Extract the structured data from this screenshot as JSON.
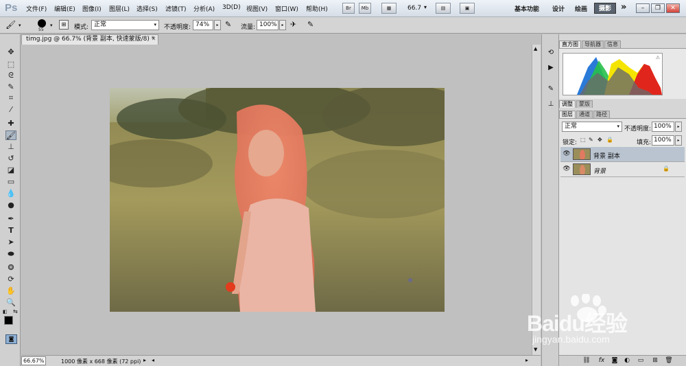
{
  "app": {
    "logo": "Ps"
  },
  "menu": [
    "文件(F)",
    "编辑(E)",
    "图像(I)",
    "图层(L)",
    "选择(S)",
    "滤镜(T)",
    "分析(A)",
    "3D(D)",
    "视图(V)",
    "窗口(W)",
    "帮助(H)"
  ],
  "menubar": {
    "btn_br": "Br",
    "btn_mb": "Mb",
    "zoom": "66.7",
    "ws_basic": "基本功能",
    "ws_design": "设计",
    "ws_paint": "绘画",
    "ws_photo": "摄影",
    "more": "»"
  },
  "options": {
    "brush_size": "55",
    "mode_label": "模式:",
    "mode_value": "正常",
    "opacity_label": "不透明度:",
    "opacity_value": "74%",
    "flow_label": "流量:",
    "flow_value": "100%"
  },
  "document": {
    "tab_title": "timg.jpg @ 66.7% (背景 副本, 快速蒙版/8) *",
    "zoom": "66.67%",
    "info": "1000 像素 x 668 像素 (72 ppi)"
  },
  "panels": {
    "top_tabs": [
      "直方图",
      "导航器",
      "信息"
    ],
    "mid_tabs": [
      "调整",
      "蒙版"
    ],
    "layer_tabs": [
      "图层",
      "通道",
      "路径"
    ],
    "blend_mode": "正常",
    "opacity_label": "不透明度:",
    "opacity_value": "100%",
    "lock_label": "锁定:",
    "fill_label": "填充:",
    "fill_value": "100%",
    "layers": [
      {
        "name": "背景 副本",
        "selected": true
      },
      {
        "name": "背景",
        "selected": false,
        "locked": true
      }
    ]
  },
  "watermark": {
    "brand": "Baidu经验",
    "url": "jingyan.baidu.com"
  },
  "colors": {
    "accent": "#5a6470",
    "menubar_top": "#eef3f8",
    "panel_bg": "#d6d6d6",
    "canvas_bg": "#c0c0c0"
  }
}
